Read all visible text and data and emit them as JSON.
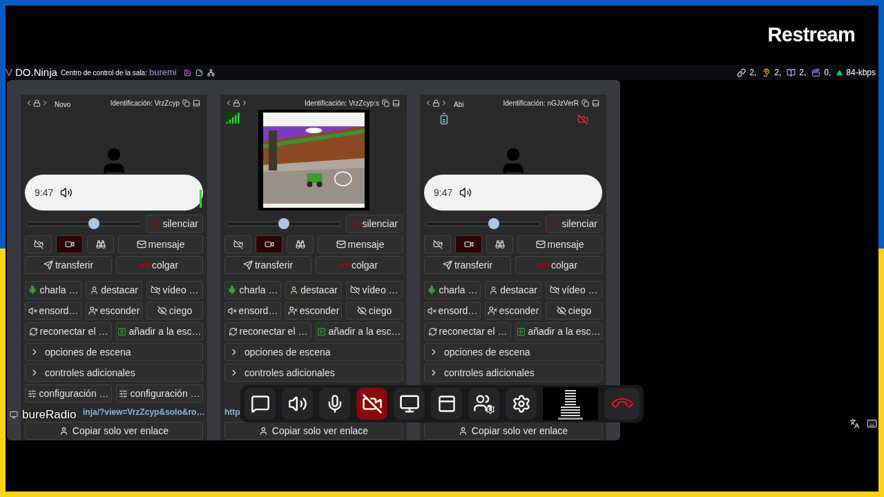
{
  "logo": "Restream",
  "header": {
    "app_prefix": "V",
    "app_name": "DO.Ninja",
    "room_label": "Centro de control de la sala:",
    "room_name": "buremi",
    "stats": [
      "2,",
      "2,",
      "2,",
      "0,",
      "84-kbps"
    ]
  },
  "cards": [
    {
      "name": "Novo",
      "id_label": "Identificación: VrzZcyp",
      "media": {
        "kind": "avatar",
        "time": "9:47",
        "meter": true
      },
      "volume": {
        "level": 0.59
      },
      "mute": "silenciar",
      "toggles": [
        {
          "selected": false
        },
        {
          "selected": true
        },
        {
          "selected": false
        }
      ],
      "buttons": [
        "mensaje",
        "transferir",
        "colgar",
        "charla …",
        "destacar",
        "vídeo …",
        "ensord…",
        "esconder",
        "ciego",
        "reconectar el …",
        "añadir a la esc…"
      ],
      "sections": [
        {
          "label": "opciones de escena",
          "expanded": false
        },
        {
          "label": "controles adicionales",
          "expanded": false
        }
      ],
      "config": [
        "configuración …",
        "configuración …"
      ],
      "link": "inja/?view=VrzZcyp&solo&ro…",
      "copy": "Copiar solo ver enlace"
    },
    {
      "id_label": "Identificación: VrzZcyp:s",
      "badge": {
        "kind": "signal"
      },
      "media": {
        "kind": "video"
      },
      "volume": {
        "level": 0.5
      },
      "mute": "silenciar",
      "toggles": [
        {
          "selected": false
        },
        {
          "selected": true
        },
        {
          "selected": false
        }
      ],
      "buttons": [
        "mensaje",
        "transferir",
        "colgar",
        "charla …",
        "destacar",
        "vídeo …",
        "ensord…",
        "esconder",
        "ciego",
        "reconectar el …",
        "añadir a la esc…"
      ],
      "sections": [
        {
          "label": "opciones de escena",
          "expanded": false
        },
        {
          "label": "controles adicionales",
          "expanded": false
        }
      ],
      "link": "http",
      "copy": "Copiar solo ver enlace"
    },
    {
      "name": "Abi",
      "id_label": "Identificación: nGJzVerR",
      "camera_off": true,
      "badge": {
        "kind": "battery"
      },
      "media": {
        "kind": "avatar",
        "time": "9:47"
      },
      "volume": {
        "level": 0.6
      },
      "mute": "silenciar",
      "toggles": [
        {
          "selected": false
        },
        {
          "selected": true
        },
        {
          "selected": false
        }
      ],
      "buttons": [
        "mensaje",
        "transferir",
        "colgar",
        "charla …",
        "destacar",
        "vídeo …",
        "ensord…",
        "esconder",
        "ciego",
        "reconectar el …",
        "añadir a la esc…"
      ],
      "sections": [
        {
          "label": "opciones de escena",
          "expanded": false
        },
        {
          "label": "controles adicionales",
          "expanded": false
        }
      ],
      "copy": "Copiar solo ver enlace"
    }
  ],
  "overlay_label": "bureRadio",
  "toolbar": {
    "camera_muted": true
  }
}
